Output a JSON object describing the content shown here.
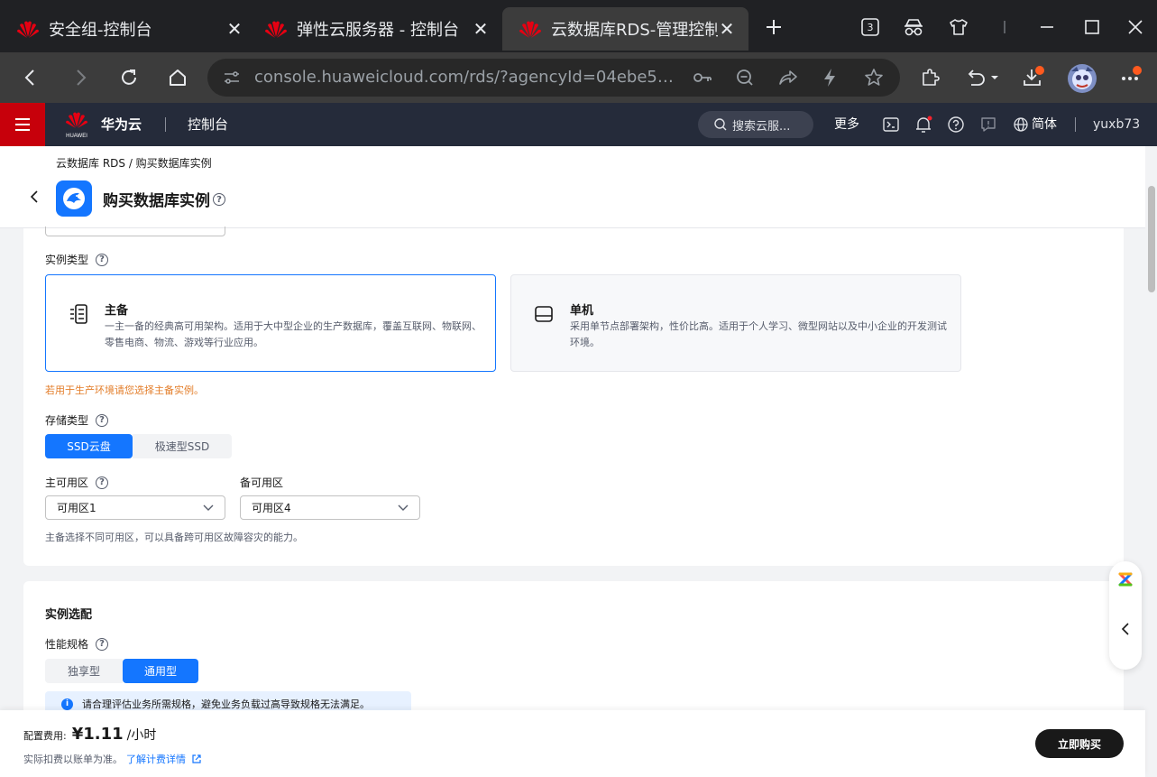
{
  "browser": {
    "tabs": [
      {
        "title": "安全组-控制台"
      },
      {
        "title": "弹性云服务器 - 控制台"
      },
      {
        "title": "云数据库RDS-管理控制台"
      }
    ],
    "tab_count": "3",
    "url": "console.huaweicloud.com/rds/?agencyId=04ebe5a6..."
  },
  "header": {
    "brand": "华为云",
    "console": "控制台",
    "logo_text": "HUAWEI",
    "search_placeholder": "搜索云服...",
    "more": "更多",
    "lang": "简体",
    "user": "yuxb73"
  },
  "page": {
    "breadcrumb": "云数据库 RDS / 购买数据库实例",
    "title": "购买数据库实例"
  },
  "instance_type": {
    "label": "实例类型",
    "options": [
      {
        "name": "主备",
        "desc": "一主一备的经典高可用架构。适用于大中型企业的生产数据库，覆盖互联网、物联网、零售电商、物流、游戏等行业应用。",
        "selected": true
      },
      {
        "name": "单机",
        "desc": "采用单节点部署架构，性价比高。适用于个人学习、微型网站以及中小企业的开发测试环境。",
        "selected": false
      }
    ],
    "warning": "若用于生产环境请您选择主备实例。"
  },
  "storage": {
    "label": "存储类型",
    "options": [
      "SSD云盘",
      "极速型SSD"
    ],
    "selected": "SSD云盘"
  },
  "zones": {
    "primary_label": "主可用区",
    "primary_value": "可用区1",
    "standby_label": "备可用区",
    "standby_value": "可用区4",
    "hint": "主备选择不同可用区，可以具备跨可用区故障容灾的能力。"
  },
  "spec": {
    "section_title": "实例选配",
    "label": "性能规格",
    "options": [
      "独享型",
      "通用型"
    ],
    "selected": "通用型",
    "info": "请合理评估业务所需规格，避免业务负载过高导致规格无法满足。"
  },
  "footer": {
    "price_label": "配置费用:",
    "price": "¥1.11",
    "price_unit": "/小时",
    "note": "实际扣费以账单为准。",
    "link": "了解计费详情",
    "buy": "立即购买"
  },
  "colors": {
    "primary": "#1476ff",
    "huawei_red": "#c7000b",
    "header_bg": "#252b3a",
    "warning": "#e37d29"
  }
}
